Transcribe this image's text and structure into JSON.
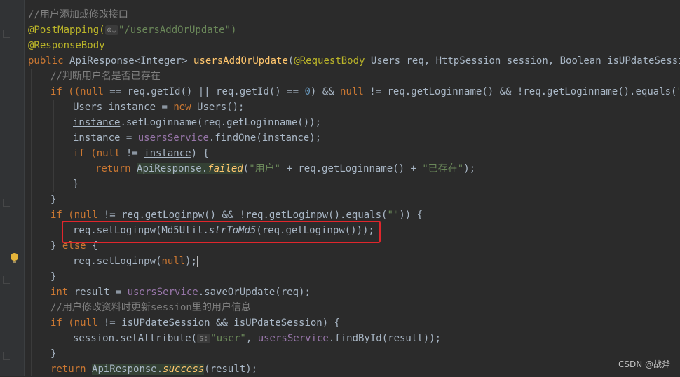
{
  "editor": {
    "hints": {
      "mapping_icon": "web-endpoint-icon",
      "param_hint": "s:"
    },
    "lines": [
      [
        "//用户添加或修改接口"
      ],
      [
        "@PostMapping(",
        "/usersAddOrUpdate",
        "\")"
      ],
      [
        "@ResponseBody"
      ],
      [
        "public ",
        "ApiResponse<Integer> ",
        "usersAddOrUpdate",
        "(",
        "@RequestBody ",
        "Users req, HttpSession session, Boolean isUPdateSession){"
      ],
      [
        "//判断用户名是否已存在"
      ],
      [
        "if ((",
        "null",
        " == req.getId() || req.getId() == ",
        "0",
        ") && ",
        "null",
        " != req.getLoginname() && !req.getLoginname().equals(",
        "\"\"",
        ")) {"
      ],
      [
        "Users ",
        "instance",
        " = ",
        "new ",
        "Users();"
      ],
      [
        "instance",
        ".setLoginname(req.getLoginname());"
      ],
      [
        "instance",
        " = ",
        "usersService",
        ".findOne(",
        "instance",
        ");"
      ],
      [
        "if (",
        "null",
        " != ",
        "instance",
        ") {"
      ],
      [
        "return ",
        "ApiResponse.",
        "failed",
        "(",
        "\"用户\"",
        " + req.getLoginname() + ",
        "\"已存在\"",
        ");"
      ],
      [
        "}"
      ],
      [
        "}"
      ],
      [
        "if (",
        "null",
        " != req.getLoginpw() && !req.getLoginpw().equals(",
        "\"\"",
        ")) {"
      ],
      [
        "req.setLoginpw(Md5Util.",
        "strToMd5",
        "(req.getLoginpw()));"
      ],
      [
        "} ",
        "else",
        " {"
      ],
      [
        "req.setLoginpw(",
        "null",
        ");"
      ],
      [
        "}"
      ],
      [
        "int ",
        "result = ",
        "usersService",
        ".saveOrUpdate(req);"
      ],
      [
        "//用户修改资料时更新session里的用户信息"
      ],
      [
        "if (",
        "null",
        " != isUPdateSession && isUPdateSession) {"
      ],
      [
        "session.setAttribute(",
        "\"user\"",
        ", ",
        "usersService",
        ".findById(result));"
      ],
      [
        "}"
      ],
      [
        "return ",
        "ApiResponse.",
        "success",
        "(result);"
      ]
    ]
  },
  "watermark": "CSDN @战斧",
  "colors": {
    "background": "#2b2b2b",
    "keyword": "#cc7832",
    "annotation": "#bbb529",
    "string": "#6a8759",
    "number": "#6897bb",
    "field": "#9876aa",
    "method": "#ffc66d",
    "comment": "#808080",
    "highlight_box": "#e0262c"
  }
}
